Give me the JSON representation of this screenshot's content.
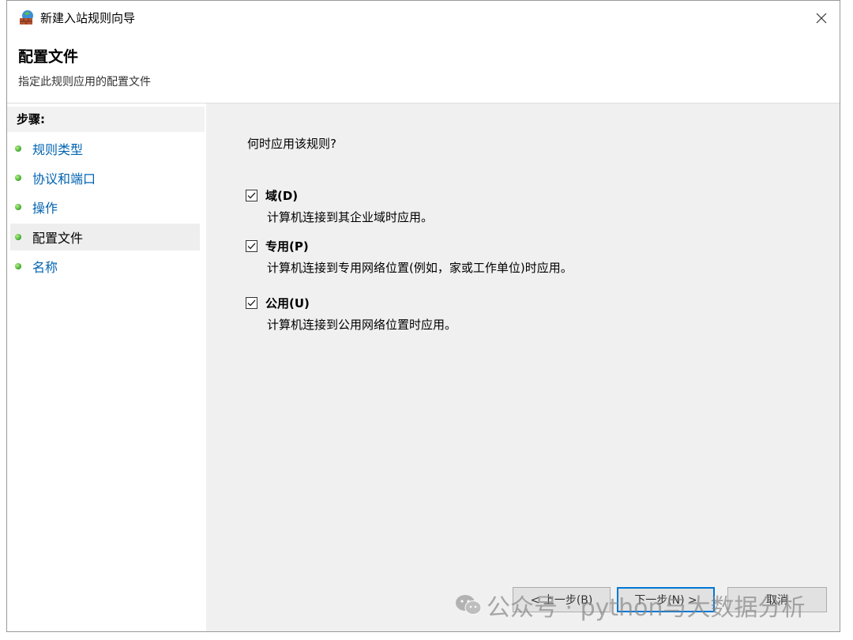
{
  "window": {
    "title": "新建入站规则向导"
  },
  "header": {
    "title": "配置文件",
    "subtitle": "指定此规则应用的配置文件"
  },
  "steps": {
    "heading": "步骤:",
    "items": [
      {
        "label": "规则类型"
      },
      {
        "label": "协议和端口"
      },
      {
        "label": "操作"
      },
      {
        "label": "配置文件",
        "current": true
      },
      {
        "label": "名称"
      }
    ]
  },
  "main": {
    "question": "何时应用该规则?",
    "options": [
      {
        "label": "域(D)",
        "description": "计算机连接到其企业域时应用。",
        "checked": true
      },
      {
        "label": "专用(P)",
        "description": "计算机连接到专用网络位置(例如，家或工作单位)时应用。",
        "checked": true
      },
      {
        "label": "公用(U)",
        "description": "计算机连接到公用网络位置时应用。",
        "checked": true
      }
    ]
  },
  "buttons": {
    "back": "< 上一步(B)",
    "next": "下一步(N) >",
    "cancel": "取消"
  },
  "watermark": {
    "text": "公众号 · python与大数据分析"
  },
  "colors": {
    "link": "#0063b1",
    "content_bg": "#f0f0f0",
    "focus_border": "#0078d7"
  },
  "icons": {
    "app": "firewall-globe-icon",
    "close": "close-icon",
    "check": "checkmark-icon",
    "step": "green-dot-icon"
  }
}
